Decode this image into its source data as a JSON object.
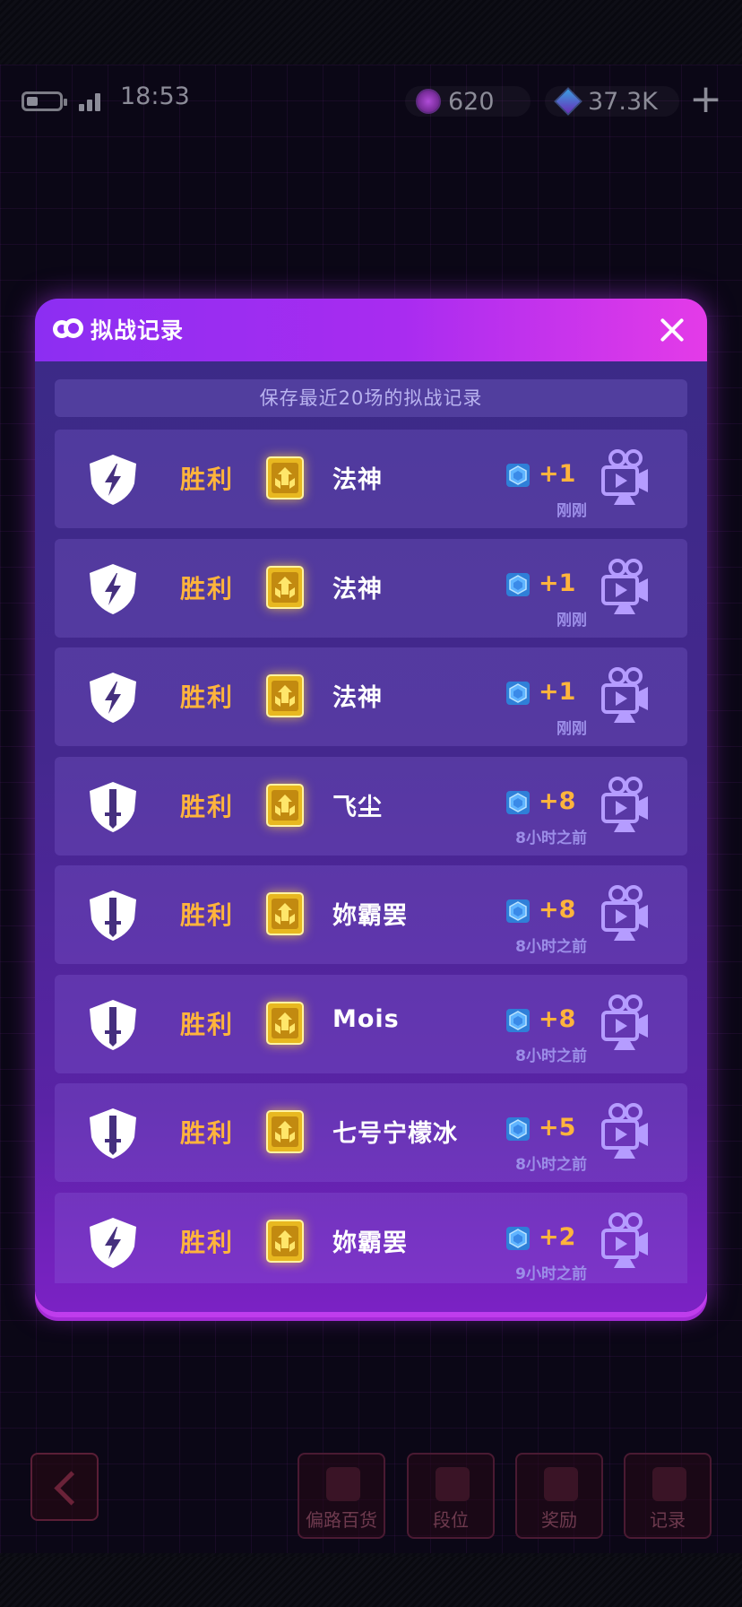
{
  "status_bar": {
    "time": "18:53",
    "currency1": "620",
    "currency2": "37.3K",
    "plus_icon": "+"
  },
  "modal": {
    "title": "拟战记录",
    "subtitle": "保存最近20场的拟战记录",
    "close_icon": "close-icon",
    "records": [
      {
        "shield": "lightning",
        "result": "胜利",
        "name": "法神",
        "score": "+1",
        "time": "刚刚"
      },
      {
        "shield": "lightning",
        "result": "胜利",
        "name": "法神",
        "score": "+1",
        "time": "刚刚"
      },
      {
        "shield": "lightning",
        "result": "胜利",
        "name": "法神",
        "score": "+1",
        "time": "刚刚"
      },
      {
        "shield": "sword",
        "result": "胜利",
        "name": "飞尘",
        "score": "+8",
        "time": "8小时之前"
      },
      {
        "shield": "sword",
        "result": "胜利",
        "name": "妳霸罢",
        "score": "+8",
        "time": "8小时之前"
      },
      {
        "shield": "sword",
        "result": "胜利",
        "name": "Mois",
        "score": "+8",
        "time": "8小时之前"
      },
      {
        "shield": "sword",
        "result": "胜利",
        "name": "七号宁檬冰",
        "score": "+5",
        "time": "8小时之前"
      },
      {
        "shield": "lightning",
        "result": "胜利",
        "name": "妳霸罢",
        "score": "+2",
        "time": "9小时之前"
      }
    ]
  },
  "bottom_nav": {
    "items": [
      "偏路百货",
      "段位",
      "奖励",
      "记录"
    ]
  },
  "colors": {
    "accent": "#ffb43c",
    "header_left": "#8c2ef2",
    "header_right": "#e43be8",
    "time_text": "#9c8ee8"
  }
}
